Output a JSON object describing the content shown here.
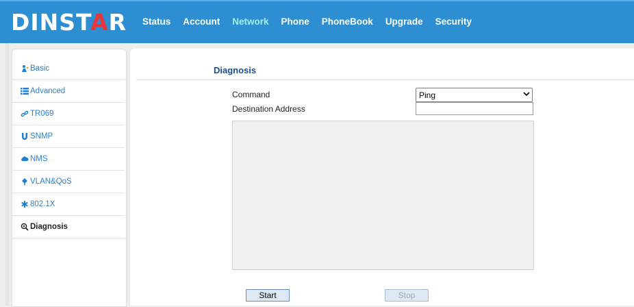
{
  "header": {
    "logo": {
      "part1": "DINST",
      "part2": "A",
      "part3": "R"
    },
    "nav": [
      {
        "label": "Status",
        "active": false
      },
      {
        "label": "Account",
        "active": false
      },
      {
        "label": "Network",
        "active": true
      },
      {
        "label": "Phone",
        "active": false
      },
      {
        "label": "PhoneBook",
        "active": false
      },
      {
        "label": "Upgrade",
        "active": false
      },
      {
        "label": "Security",
        "active": false
      }
    ]
  },
  "sidebar": {
    "items": [
      {
        "label": "Basic",
        "icon": "person-network-icon"
      },
      {
        "label": "Advanced",
        "icon": "list-icon"
      },
      {
        "label": "TR069",
        "icon": "link-icon"
      },
      {
        "label": "SNMP",
        "icon": "magnet-icon"
      },
      {
        "label": "NMS",
        "icon": "cloud-icon"
      },
      {
        "label": "VLAN&QoS",
        "icon": "diamond-icon"
      },
      {
        "label": "802.1X",
        "icon": "asterisk-icon"
      },
      {
        "label": "Diagnosis",
        "icon": "zoom-icon",
        "active": true
      }
    ]
  },
  "main": {
    "title": "Diagnosis",
    "command_label": "Command",
    "command_value": "Ping",
    "destination_label": "Destination Address",
    "destination_value": "",
    "start_label": "Start",
    "stop_label": "Stop"
  },
  "colors": {
    "header_bg": "#2d8fd1",
    "nav_active": "#9ff0ea",
    "logo_accent": "#e8343b",
    "sidebar_link": "#2a7fd0",
    "title": "#1d4c8a"
  }
}
